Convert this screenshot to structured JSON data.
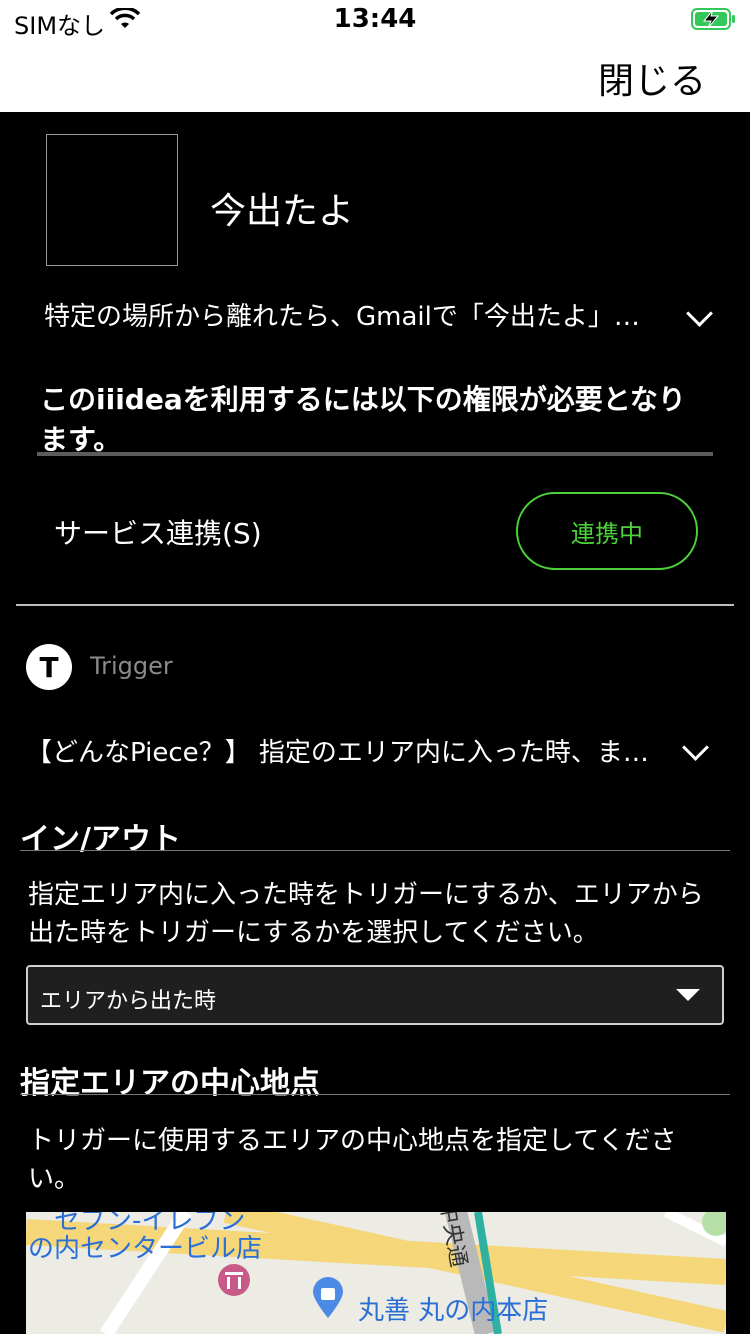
{
  "status_bar": {
    "carrier": "SIMなし",
    "time": "13:44"
  },
  "nav": {
    "close_label": "閉じる"
  },
  "recipe": {
    "title": "今出たよ",
    "description": "特定の場所から離れたら、Gmailで「今出たよ」とメールを送ります。",
    "permission_notice": "このiiideaを利用するには以下の権限が必要となります。",
    "service_label": "サービス連携(S)",
    "service_status": "連携中"
  },
  "trigger": {
    "badge": "T",
    "label": "Trigger",
    "piece_summary": "【どんなPiece？】 指定のエリア内に入った時、またはエリアから出た時"
  },
  "inout": {
    "heading": "イン/アウト",
    "description": "指定エリア内に入った時をトリガーにするか、エリアから出た時をトリガーにするかを選択してください。",
    "selected": "エリアから出た時"
  },
  "center_point": {
    "heading": "指定エリアの中心地点",
    "description": "トリガーに使用するエリアの中心地点を指定してください。"
  },
  "map": {
    "labels": [
      "セブン-イレブン",
      "の内センタービル店",
      "中央通",
      "丸善 丸の内本店"
    ]
  },
  "colors": {
    "accent": "#4cd13a",
    "battery": "#34c759",
    "map_link": "#2a6fd6"
  }
}
